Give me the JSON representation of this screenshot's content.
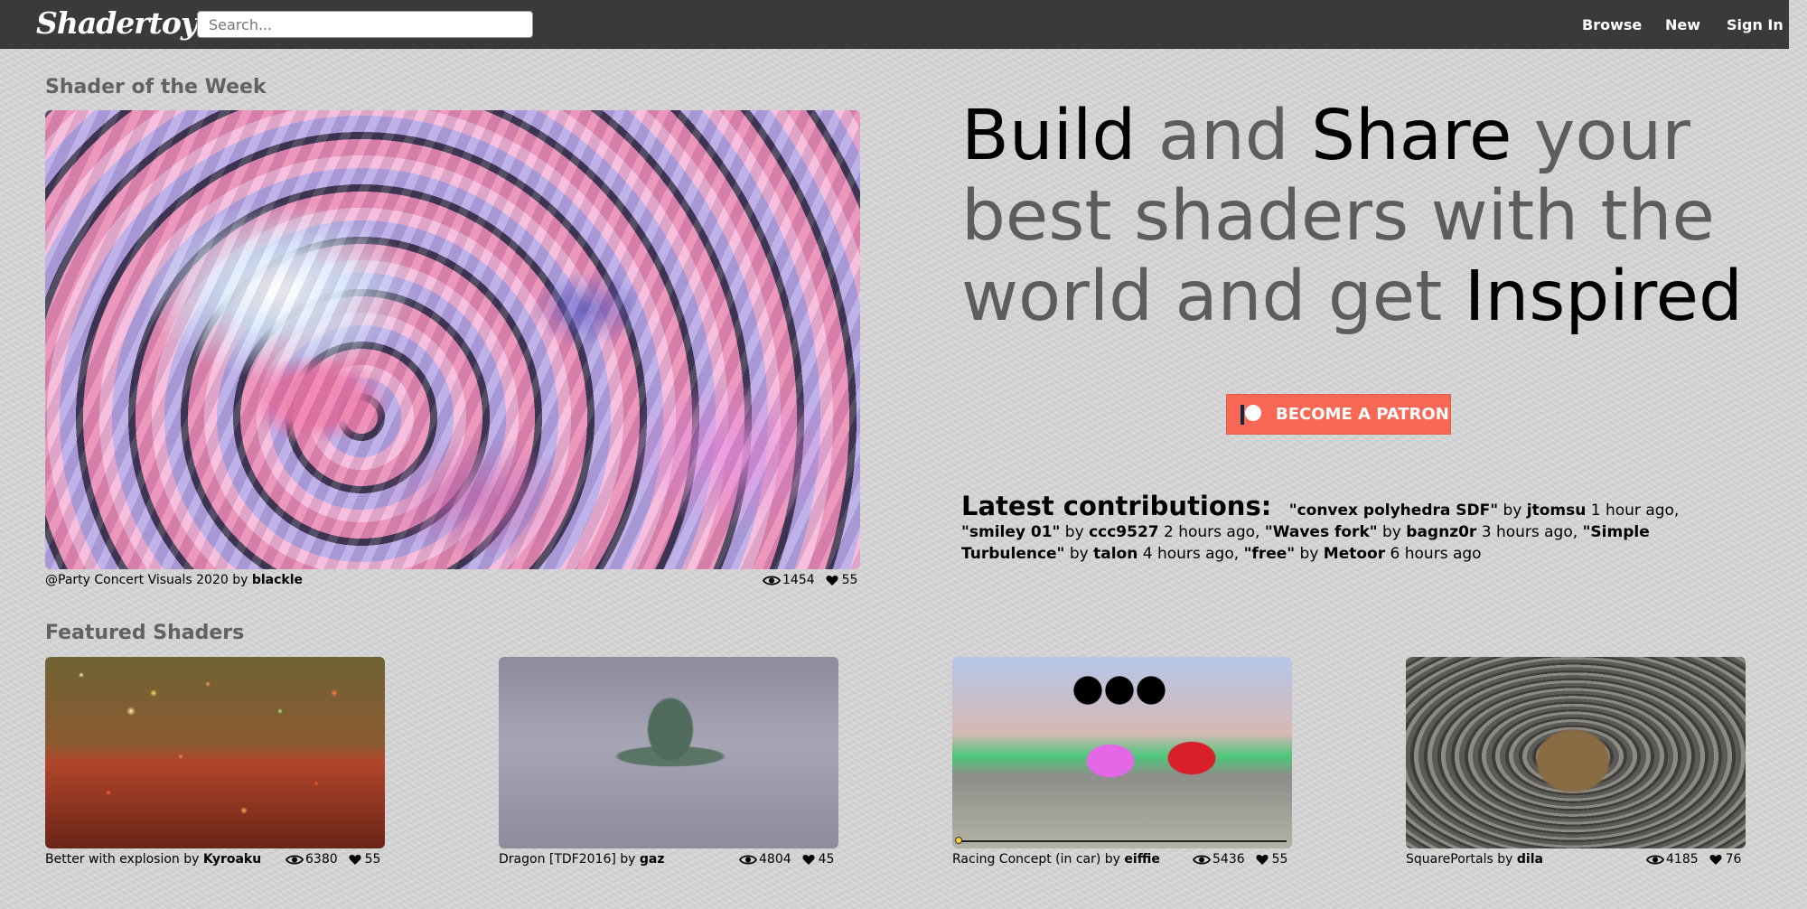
{
  "header": {
    "logo": "Shadertoy",
    "search_placeholder": "Search...",
    "nav": [
      "Browse",
      "New",
      "Sign In"
    ]
  },
  "shader_of_week": {
    "section_title": "Shader of the Week",
    "name": "@Party Concert Visuals 2020",
    "by": "by",
    "author": "blackle",
    "views": "1454",
    "likes": "55"
  },
  "hero": {
    "words": [
      "Build",
      " and ",
      "Share",
      " your best shaders with the world and get ",
      "Inspired"
    ]
  },
  "patron": {
    "label": "BECOME A PATRON",
    "color": "#f96854"
  },
  "latest": {
    "title": "Latest contributions:",
    "items": [
      {
        "name": "\"convex polyhedra SDF\"",
        "author": "jtomsu",
        "time": "1 hour ago"
      },
      {
        "name": "\"smiley 01\"",
        "author": "ccc9527",
        "time": "2 hours ago"
      },
      {
        "name": "\"Waves fork\"",
        "author": "bagnz0r",
        "time": "3 hours ago"
      },
      {
        "name": "\"Simple Turbulence\"",
        "author": "talon",
        "time": "4 hours ago"
      },
      {
        "name": "\"free\"",
        "author": "Metoor",
        "time": "6 hours ago"
      }
    ]
  },
  "featured": {
    "section_title": "Featured Shaders",
    "items": [
      {
        "name": "Better with explosion",
        "by": "by",
        "author": "Kyroaku",
        "views": "6380",
        "likes": "55"
      },
      {
        "name": "Dragon [TDF2016]",
        "by": "by",
        "author": "gaz",
        "views": "4804",
        "likes": "45"
      },
      {
        "name": "Racing Concept (in car)",
        "by": "by",
        "author": "eiffie",
        "views": "5436",
        "likes": "55"
      },
      {
        "name": "SquarePortals",
        "by": "by",
        "author": "dila",
        "views": "4185",
        "likes": "76"
      }
    ]
  },
  "icons": {
    "views": "eye-icon",
    "likes": "heart-icon"
  }
}
